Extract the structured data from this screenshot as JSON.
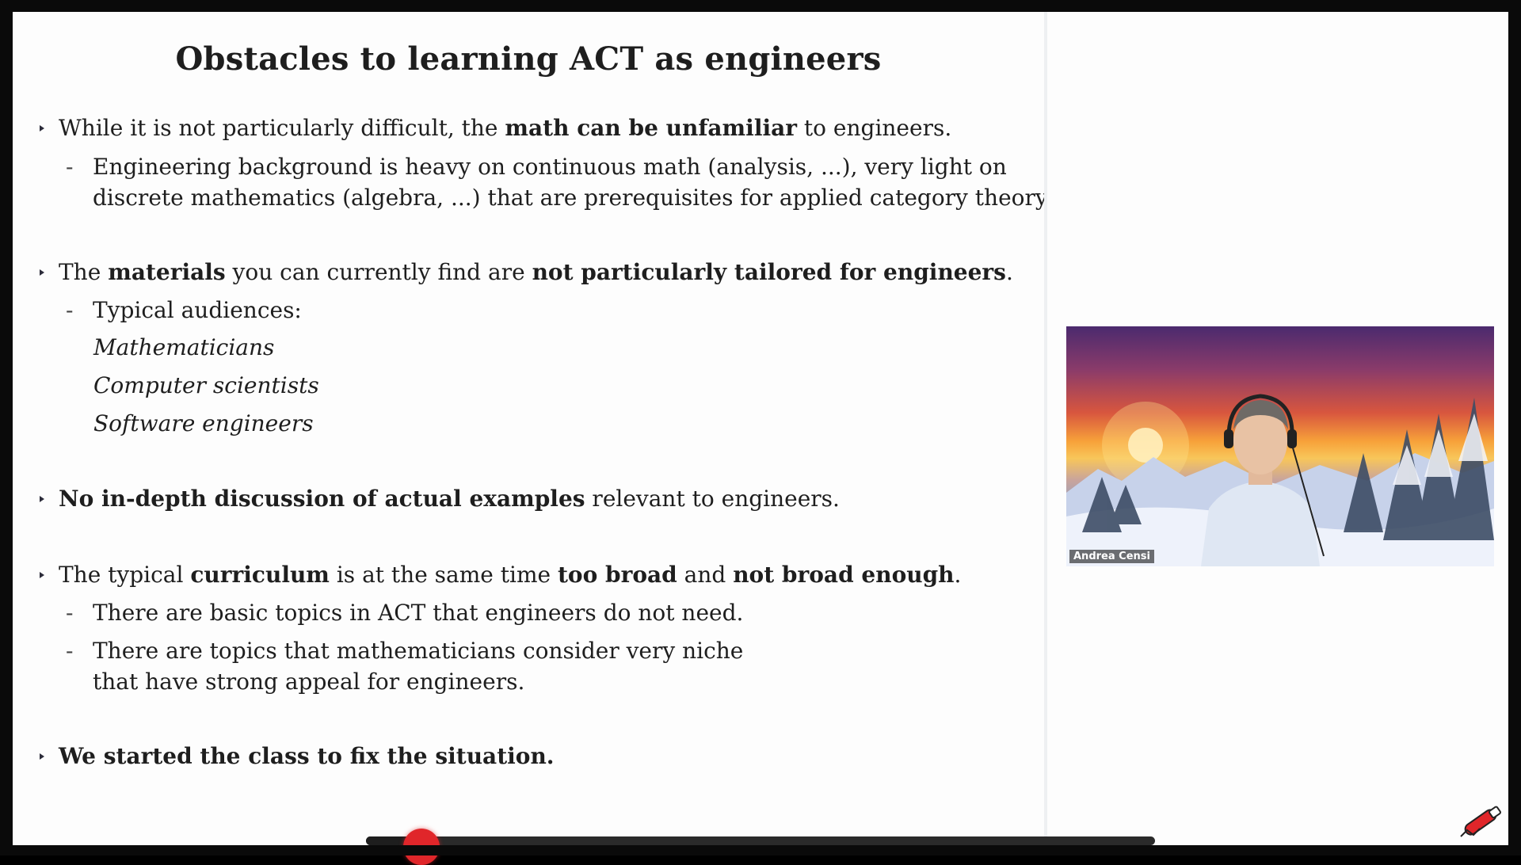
{
  "slide": {
    "title": "Obstacles to learning ACT as engineers",
    "b1": {
      "pre": "While it is not particularly difficult, the ",
      "bold": "math can be unfamiliar",
      "post": " to engineers."
    },
    "b1_sub1_line1": "Engineering background is heavy on continuous math (analysis, ...), very light on",
    "b1_sub1_line2": "discrete mathematics (algebra, ...) that are prerequisites for applied category theory.",
    "b2": {
      "pre": "The ",
      "bold1": "materials",
      "mid": " you can currently find are ",
      "bold2": "not particularly tailored for engineers",
      "post": "."
    },
    "b2_sub1": "Typical audiences:",
    "audiences": [
      "Mathematicians",
      "Computer scientists",
      "Software engineers"
    ],
    "b3": {
      "bold": "No in-depth discussion of actual examples",
      "post": " relevant to engineers."
    },
    "b4": {
      "pre": "The typical ",
      "bold1": "curriculum",
      "mid1": " is at the same time ",
      "bold2": "too broad",
      "mid2": " and ",
      "bold3": "not broad enough",
      "post": "."
    },
    "b4_sub1": "There are basic topics in ACT that engineers do not need.",
    "b4_sub2_line1": "There are topics that mathematicians consider very niche",
    "b4_sub2_line2": "that have strong appeal for engineers.",
    "b5": "We started the class to fix the situation.",
    "dash": "-"
  },
  "video": {
    "participant_name": "Andrea Censi"
  },
  "player": {
    "progress": 0.07
  },
  "colors": {
    "progress_dot": "#e0262a",
    "slide_bg": "#fdfdfd"
  }
}
